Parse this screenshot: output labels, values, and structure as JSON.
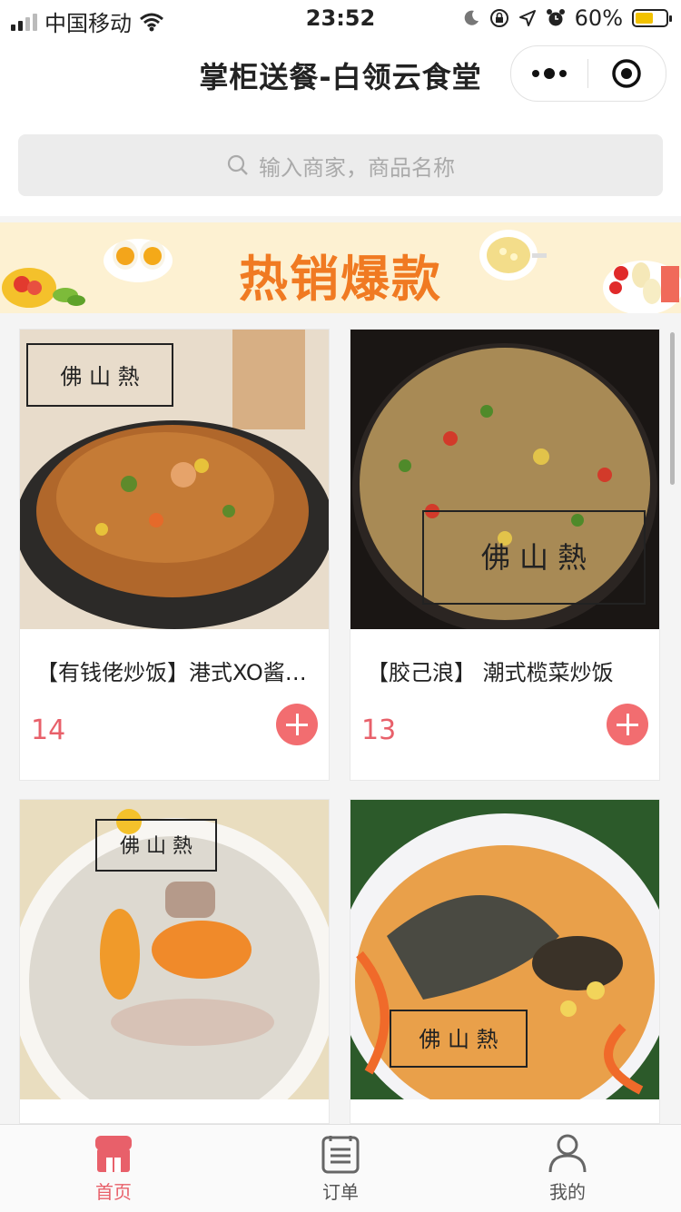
{
  "status_bar": {
    "carrier": "中国移动",
    "time": "23:52",
    "battery_percent": "60%",
    "battery_level": 0.6
  },
  "nav": {
    "title": "掌柜送餐-白领云食堂"
  },
  "search": {
    "placeholder": "输入商家，商品名称"
  },
  "banner": {
    "text": "热销爆款"
  },
  "products": [
    {
      "name": "【有钱佬炒饭】港式XO酱炒饭",
      "price": "14"
    },
    {
      "name": "【胶己浪】 潮式榄菜炒饭",
      "price": "13"
    },
    {
      "name": "",
      "price": ""
    },
    {
      "name": "",
      "price": ""
    }
  ],
  "tabbar": {
    "items": [
      {
        "label": "首页"
      },
      {
        "label": "订单"
      },
      {
        "label": "我的"
      }
    ]
  },
  "colors": {
    "accent": "#e8606a",
    "banner_text": "#f07a22",
    "banner_bg": "#fdf1d2"
  }
}
